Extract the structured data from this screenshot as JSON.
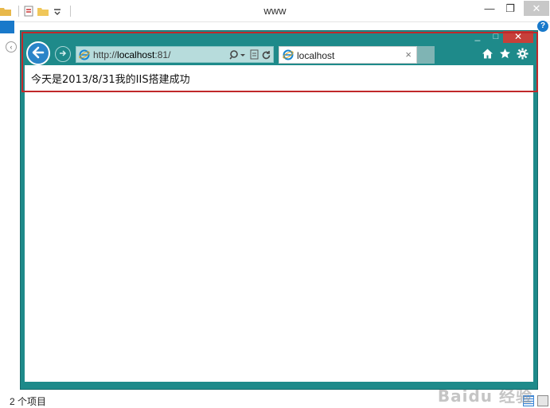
{
  "explorer": {
    "title": "www",
    "status_text": "2 个项目",
    "help_label": "?",
    "watermark": "Baidu 经验"
  },
  "ie": {
    "address_prefix": "http://",
    "address_host": "localhost",
    "address_suffix": ":81/",
    "tab_label": "localhost",
    "tab_close": "×",
    "page_text": "今天是2013/8/31我的IIS搭建成功"
  },
  "icons": {
    "back": "back-arrow-icon",
    "forward": "forward-arrow-icon",
    "search": "search-icon",
    "compat": "compatibility-view-icon",
    "refresh": "refresh-icon",
    "home": "home-icon",
    "favorites": "star-icon",
    "tools": "gear-icon"
  },
  "colors": {
    "ie_frame": "#1e8a8a",
    "ie_close": "#c7403a",
    "highlight": "#c0282a",
    "back_button": "#2a84c8"
  }
}
